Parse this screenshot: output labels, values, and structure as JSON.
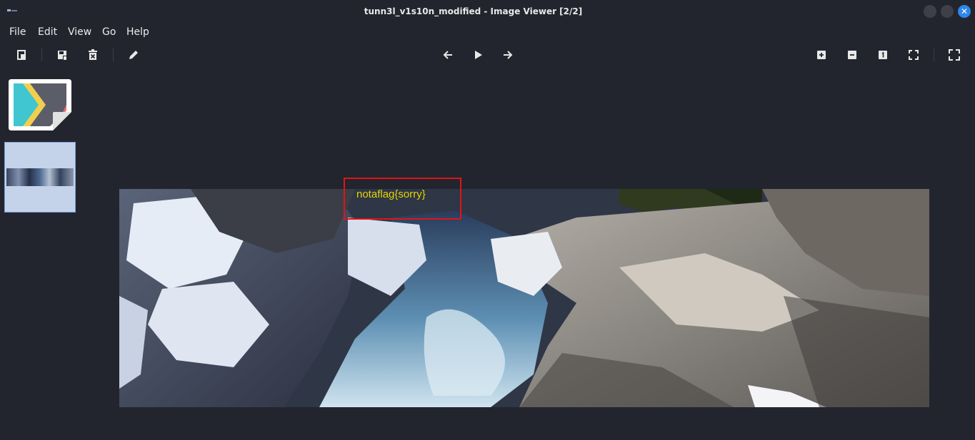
{
  "window": {
    "title": "tunn3l_v1s10n_modified - Image Viewer [2/2]",
    "close_glyph": "✕"
  },
  "menu": [
    "File",
    "Edit",
    "View",
    "Go",
    "Help"
  ],
  "toolbar": {
    "left": [
      "open-icon",
      "save-icon",
      "delete-icon",
      "edit-icon"
    ],
    "center": [
      "previous-icon",
      "play-slideshow-icon",
      "next-icon"
    ],
    "right": [
      "zoom-in-icon",
      "zoom-out-icon",
      "actual-size-icon",
      "zoom-fit-icon",
      "fullscreen-icon"
    ]
  },
  "sidebar": {
    "thumbnails": [
      {
        "name": "thumbnail-app-icon",
        "selected": false
      },
      {
        "name": "thumbnail-waterfall",
        "selected": true
      }
    ]
  },
  "image": {
    "annotation_text": "notaflag{sorry}",
    "annotation_color": "#e01414",
    "annotation_text_color": "#e5d500"
  },
  "colors": {
    "background": "#23252e",
    "accent": "#2f86ea",
    "selection": "#c5d3ea"
  }
}
